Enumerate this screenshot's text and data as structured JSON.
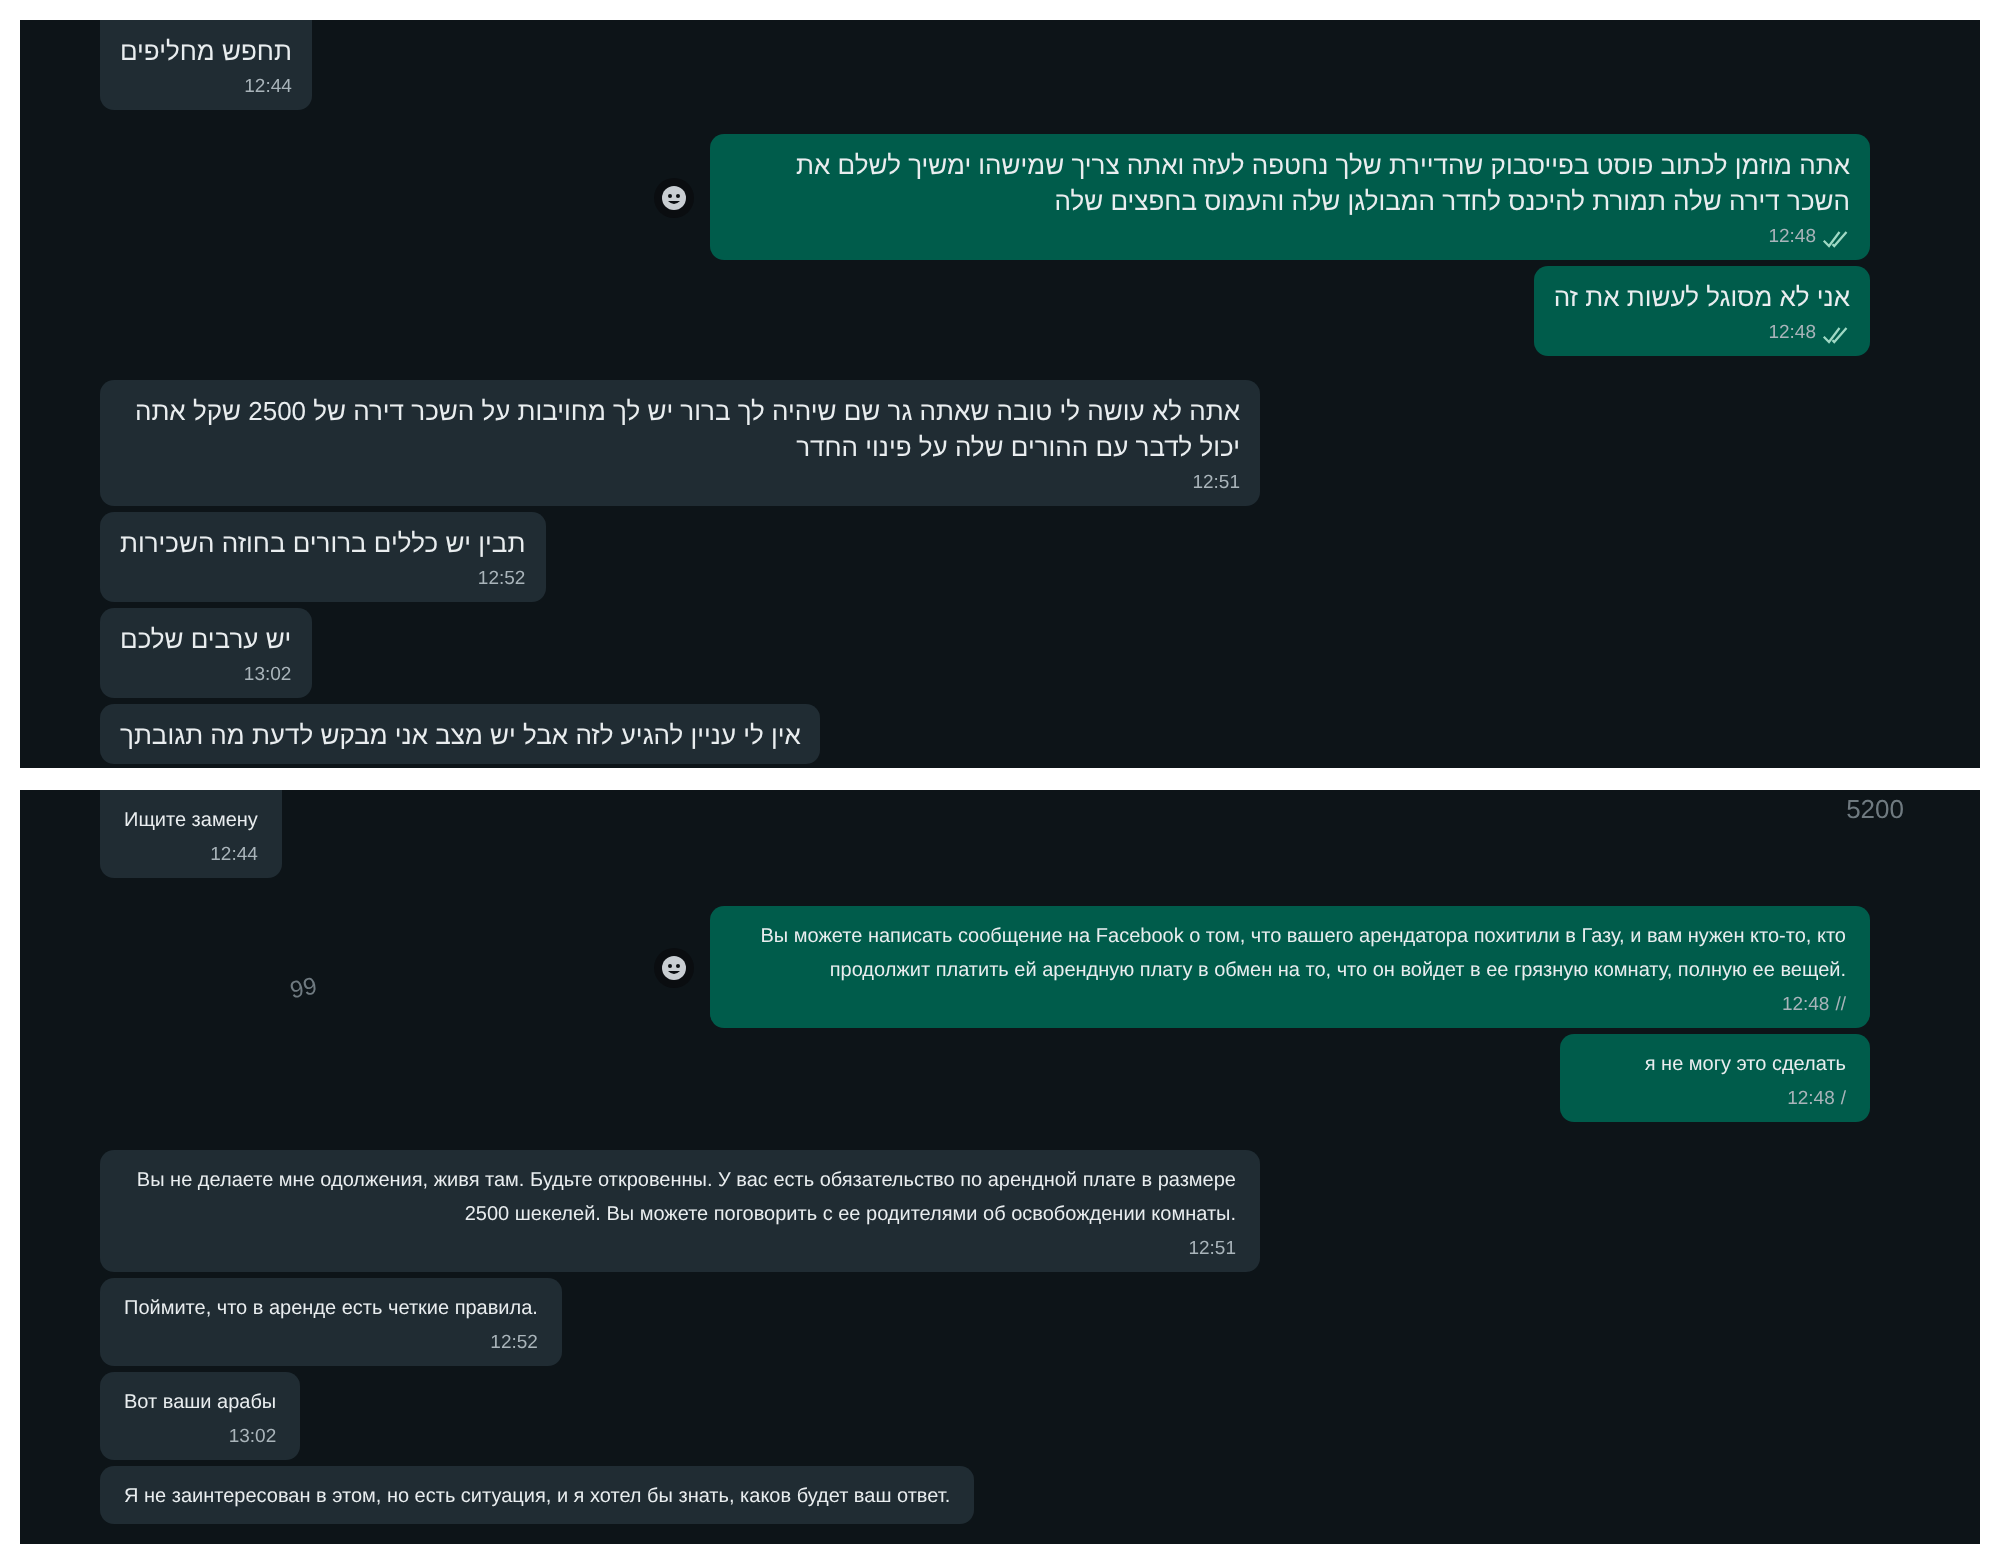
{
  "panels": [
    {
      "kind": "rtl",
      "messages": [
        {
          "kind": "in",
          "text": "תחפש מחליפים",
          "time": "12:44"
        },
        {
          "kind": "out",
          "text": "אתה מוזמן לכתוב פוסט בפייסבוק שהדיירת שלך נחטפה לעזה ואתה צריך שמישהו ימשיך לשלם את השכר דירה שלה תמורת להיכנס לחדר המבולגן שלה והעמוס בחפצים שלה",
          "time": "12:48",
          "read": true,
          "reaction": true
        },
        {
          "kind": "out",
          "text": "אני לא מסוגל לעשות את זה",
          "time": "12:48",
          "read": true,
          "reaction": false
        },
        {
          "kind": "in",
          "text": "אתה לא עושה לי טובה שאתה גר שם שיהיה לך ברור יש לך מחויבות על השכר דירה של 2500 שקל אתה יכול לדבר עם ההורים שלה על פינוי החדר",
          "time": "12:51"
        },
        {
          "kind": "in",
          "text": "תבין יש כללים ברורים בחוזה השכירות",
          "time": "12:52"
        },
        {
          "kind": "in",
          "text": "יש ערבים שלכם",
          "time": "13:02"
        },
        {
          "kind": "in",
          "text": "אין לי עניין להגיע לזה אבל יש מצב אני מבקש לדעת מה תגובתך"
        }
      ]
    },
    {
      "kind": "ltr",
      "stray_labels": [
        "99",
        "5200"
      ],
      "messages": [
        {
          "kind": "in",
          "text": "Ищите замену",
          "time": "12:44"
        },
        {
          "kind": "out",
          "text": "Вы можете написать сообщение на Facebook о том, что вашего арендатора похитили в Газу, и вам нужен кто-то, кто продолжит платить ей арендную плату в обмен на то, что он войдет в ее грязную комнату, полную ее вещей.",
          "time": "12:48",
          "receipt": "//",
          "read": false,
          "reaction": true
        },
        {
          "kind": "out",
          "text": "я не могу это сделать",
          "time": "12:48",
          "receipt": "/",
          "read": false,
          "reaction": false
        },
        {
          "kind": "in",
          "text": "Вы не делаете мне одолжения, живя там. Будьте откровенны. У вас есть обязательство по арендной плате в размере 2500 шекелей. Вы можете поговорить с ее родителями об освобождении комнаты.",
          "time": "12:51"
        },
        {
          "kind": "in",
          "text": "Поймите, что в аренде есть четкие правила.",
          "time": "12:52"
        },
        {
          "kind": "in",
          "text": "Вот ваши арабы",
          "time": "13:02"
        },
        {
          "kind": "in",
          "text": "Я не заинтересован в этом, но есть ситуация, и я хотел бы знать, каков будет ваш ответ."
        }
      ]
    }
  ]
}
